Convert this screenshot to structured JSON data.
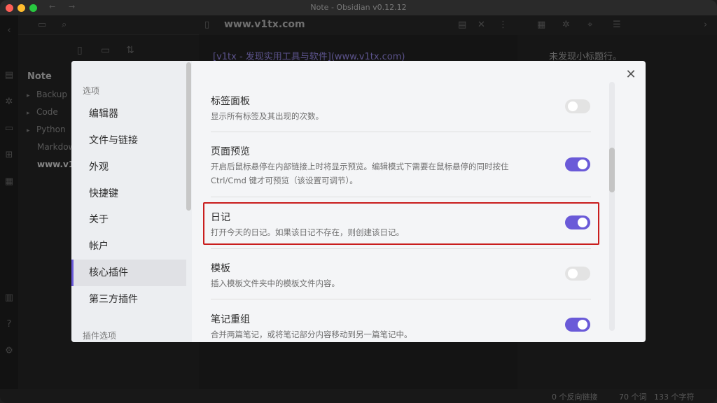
{
  "window": {
    "title": "Note - Obsidian v0.12.12",
    "nav_back": "←",
    "nav_forward": "→"
  },
  "colors": {
    "accent": "#6a5ad8",
    "highlight": "#c91d1d"
  },
  "ribbon_icons": [
    "doc-icon",
    "graph-icon",
    "cards-icon",
    "plugin-icon",
    "calendar-icon",
    "vault-icon",
    "help-icon",
    "settings-icon"
  ],
  "file_explorer": {
    "vault_name": "Note",
    "items": [
      {
        "label": "Backup",
        "caret": "▸"
      },
      {
        "label": "Code",
        "caret": "▸"
      },
      {
        "label": "Python",
        "caret": "▸"
      },
      {
        "label": "Markdow",
        "caret": ""
      }
    ],
    "active_file": "www.v1tx"
  },
  "editor": {
    "title": "www.v1tx.com",
    "link_text": "[v1tx - 发现实用工具与软件](www.v1tx.com)"
  },
  "right_panel": {
    "outline_empty": "未发现小标题行。"
  },
  "status_bar": {
    "backlinks": "0 个反向链接",
    "words": "70 个词",
    "chars": "133 个字符"
  },
  "settings": {
    "sidebar": {
      "heading_options": "选项",
      "items": [
        {
          "label": "编辑器",
          "active": false
        },
        {
          "label": "文件与链接",
          "active": false
        },
        {
          "label": "外观",
          "active": false
        },
        {
          "label": "快捷键",
          "active": false
        },
        {
          "label": "关于",
          "active": false
        },
        {
          "label": "帐户",
          "active": false
        },
        {
          "label": "核心插件",
          "active": true
        },
        {
          "label": "第三方插件",
          "active": false
        }
      ],
      "heading_plugin_options": "插件选项"
    },
    "close_label": "✕",
    "plugins": [
      {
        "name": "标签面板",
        "desc": "显示所有标签及其出现的次数。",
        "enabled": false
      },
      {
        "name": "页面预览",
        "desc": "开启后鼠标悬停在内部链接上时将显示预览。编辑模式下需要在鼠标悬停的同时按住 Ctrl/Cmd 键才可预览（该设置可调节）。",
        "enabled": true
      },
      {
        "name": "日记",
        "desc": "打开今天的日记。如果该日记不存在，则创建该日记。",
        "enabled": true
      },
      {
        "name": "模板",
        "desc": "插入模板文件夹中的模板文件内容。",
        "enabled": false
      },
      {
        "name": "笔记重组",
        "desc": "合并两篇笔记，或将笔记部分内容移动到另一篇笔记中。",
        "enabled": true
      }
    ]
  }
}
